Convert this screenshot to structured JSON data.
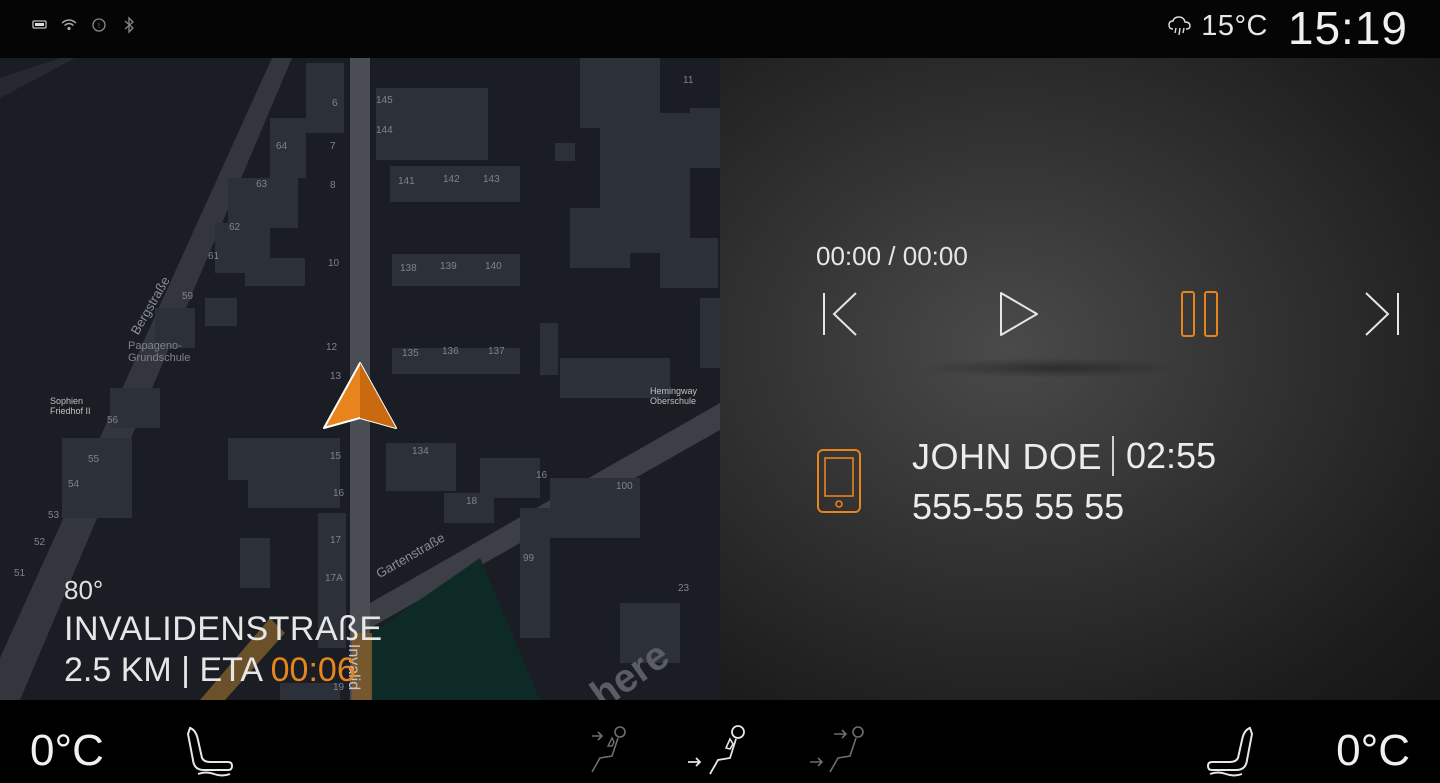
{
  "status_bar": {
    "icons": [
      "battery-icon",
      "wifi-icon",
      "signal-icon",
      "bluetooth-icon"
    ],
    "weather_icon": "cloud-rain-icon",
    "outside_temp": "15°C",
    "clock": "15:19"
  },
  "map": {
    "streets": [
      "Bergstraße",
      "Gartenstraße",
      "Invalid"
    ],
    "places": [
      "Papageno-Grundschule",
      "Sophien Friedhof II",
      "Hemingway Oberschule"
    ],
    "building_numbers": [
      "6",
      "7",
      "8",
      "10",
      "12",
      "13",
      "15",
      "16",
      "17",
      "17A",
      "19",
      "145",
      "144",
      "141",
      "142",
      "143",
      "138",
      "139",
      "140",
      "135",
      "136",
      "137",
      "134",
      "18",
      "16",
      "100",
      "99",
      "23",
      "11",
      "64",
      "63",
      "62",
      "61",
      "59",
      "56",
      "55",
      "54",
      "53",
      "52",
      "51"
    ],
    "brand": "here",
    "nav": {
      "bearing": "80°",
      "street": "INVALIDENSTRAßE",
      "distance": "2.5 KM",
      "eta_label": "ETA",
      "eta_time": "00:06"
    }
  },
  "media": {
    "progress": "00:00 / 00:00",
    "controls": [
      "previous-icon",
      "play-icon",
      "pause-icon",
      "next-icon"
    ],
    "accent_color": "#e8841c"
  },
  "call": {
    "name": "JOHN DOE",
    "duration": "02:55",
    "number": "555-55 55 55"
  },
  "climate": {
    "left_temp": "0°C",
    "right_temp": "0°C",
    "icons": [
      "left-seat-heat-icon",
      "airflow-face-icon",
      "airflow-feet-icon",
      "airflow-defrost-icon",
      "right-seat-heat-icon"
    ]
  }
}
